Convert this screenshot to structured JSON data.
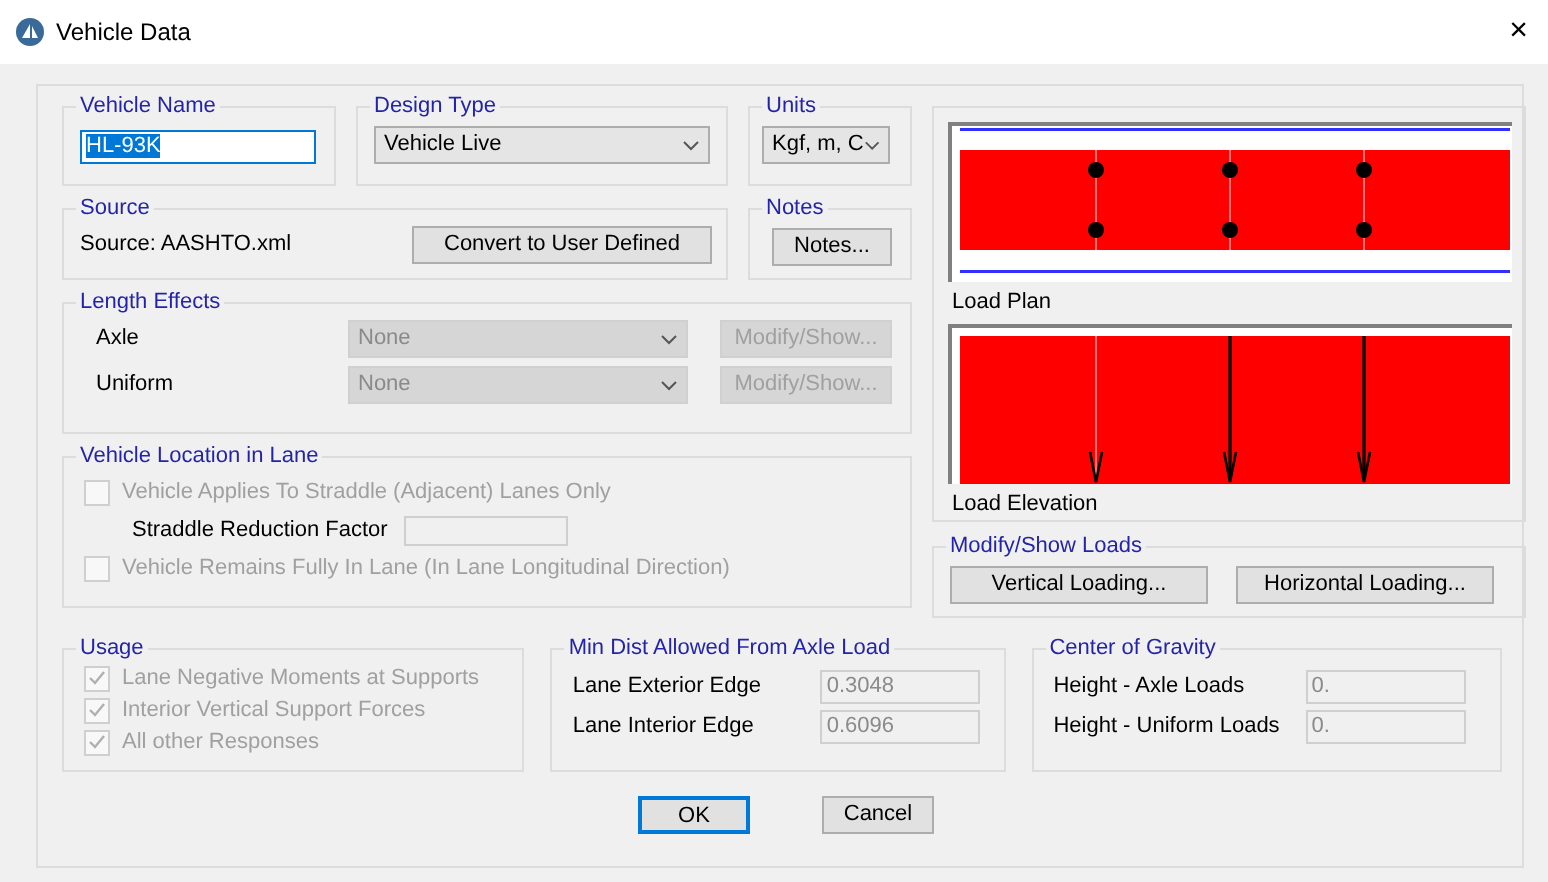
{
  "window": {
    "title": "Vehicle Data",
    "close": "×"
  },
  "vehicle_name": {
    "label": "Vehicle Name",
    "value": "HL-93K",
    "highlighted": true
  },
  "design_type": {
    "label": "Design Type",
    "value": "Vehicle Live"
  },
  "units": {
    "label": "Units",
    "value": "Kgf, m, C"
  },
  "source": {
    "label": "Source",
    "text": "Source: AASHTO.xml",
    "button": "Convert to User Defined"
  },
  "notes": {
    "label": "Notes",
    "button": "Notes..."
  },
  "length_effects": {
    "label": "Length Effects",
    "rows": [
      {
        "label": "Axle",
        "value": "None",
        "button": "Modify/Show...",
        "disabled": true
      },
      {
        "label": "Uniform",
        "value": "None",
        "button": "Modify/Show...",
        "disabled": true
      }
    ]
  },
  "vehicle_location": {
    "label": "Vehicle Location in Lane",
    "items": [
      {
        "kind": "checkbox",
        "label": "Vehicle Applies To Straddle (Adjacent) Lanes Only",
        "checked": false,
        "disabled": true
      },
      {
        "kind": "field",
        "label": "Straddle Reduction Factor",
        "disabled": true
      },
      {
        "kind": "checkbox",
        "label": "Vehicle Remains Fully In Lane (In Lane Longitudinal Direction)",
        "checked": false,
        "disabled": true
      }
    ]
  },
  "load_plan": {
    "caption": "Load Plan"
  },
  "load_elevation": {
    "caption": "Load Elevation"
  },
  "modify_show_loads": {
    "label": "Modify/Show Loads",
    "buttons": [
      "Vertical Loading...",
      "Horizontal Loading..."
    ]
  },
  "usage": {
    "label": "Usage",
    "items": [
      {
        "label": "Lane Negative Moments at Supports",
        "checked": true,
        "disabled": true
      },
      {
        "label": "Interior Vertical Support Forces",
        "checked": true,
        "disabled": true
      },
      {
        "label": "All other Responses",
        "checked": true,
        "disabled": true
      }
    ]
  },
  "min_dist": {
    "label": "Min Dist Allowed From Axle Load",
    "fields": [
      {
        "label": "Lane Exterior Edge",
        "value": "0.3048",
        "disabled": true
      },
      {
        "label": "Lane Interior Edge",
        "value": "0.6096",
        "disabled": true
      }
    ]
  },
  "center_of_gravity": {
    "label": "Center of Gravity",
    "fields": [
      {
        "label": "Height - Axle Loads",
        "value": "0.",
        "disabled": true
      },
      {
        "label": "Height - Uniform Loads",
        "value": "0.",
        "disabled": true
      }
    ]
  },
  "buttons": [
    {
      "label": "OK",
      "default": true
    },
    {
      "label": "Cancel",
      "default": false
    }
  ]
}
